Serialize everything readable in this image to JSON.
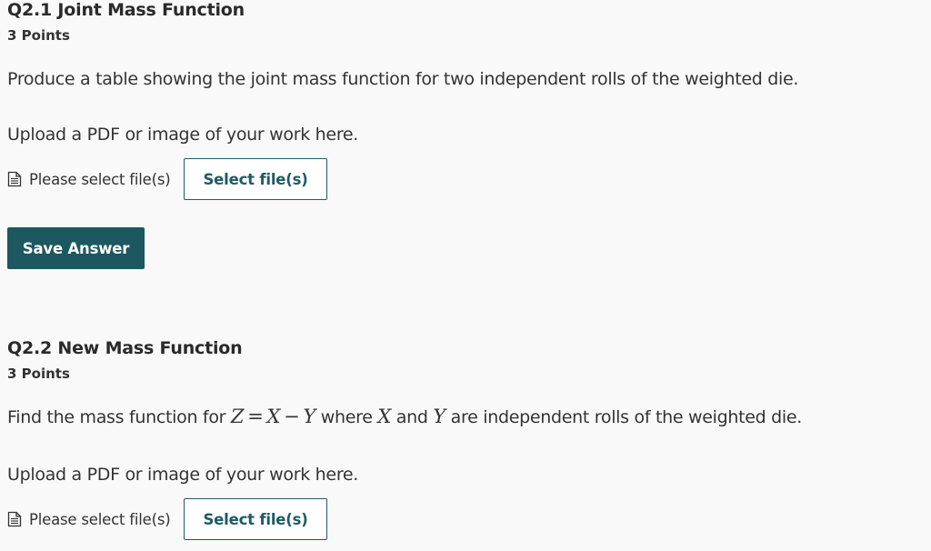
{
  "q1": {
    "title": "Q2.1 Joint Mass Function",
    "points": "3 Points",
    "prompt": "Produce a table showing the joint mass function for two independent rolls of the weighted die.",
    "upload_text": "Upload a PDF or image of your work here.",
    "file_icon": "file-document-icon",
    "file_status": "Please select file(s)",
    "select_button": "Select file(s)",
    "save_button": "Save Answer"
  },
  "q2": {
    "title": "Q2.2 New Mass Function",
    "points": "3 Points",
    "prompt": {
      "before": "Find the mass function for ",
      "var_z": "Z",
      "eq": "=",
      "var_x": "X",
      "minus": "−",
      "var_y": "Y",
      "mid1": " where ",
      "var_x2": "X",
      "mid2": " and ",
      "var_y2": "Y",
      "after": " are independent rolls of the weighted die."
    },
    "upload_text": "Upload a PDF or image of your work here.",
    "file_icon": "file-document-icon",
    "file_status": "Please select file(s)",
    "select_button": "Select file(s)"
  },
  "colors": {
    "accent": "#1d5860",
    "background": "#f9f9f9"
  }
}
